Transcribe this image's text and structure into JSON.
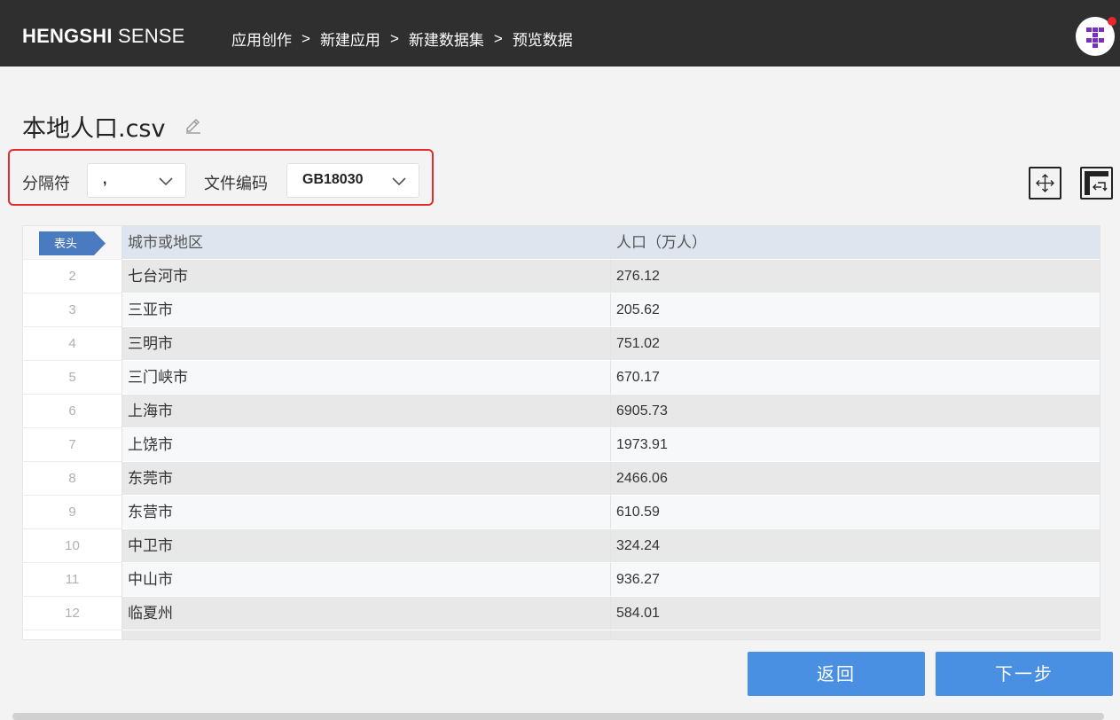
{
  "app": {
    "logo_bold": "HENGSHI",
    "logo_light": " SENSE"
  },
  "breadcrumb": [
    {
      "label": "应用创作"
    },
    {
      "label": "新建应用"
    },
    {
      "label": "新建数据集"
    },
    {
      "label": "预览数据"
    }
  ],
  "breadcrumb_separator": ">",
  "page": {
    "title": "本地人口.csv"
  },
  "options": {
    "delimiter_label": "分隔符",
    "delimiter_value": ",",
    "encoding_label": "文件编码",
    "encoding_value": "GB18030"
  },
  "table": {
    "header_tag": "表头",
    "columns": [
      "城市或地区",
      "人口（万人）"
    ],
    "rows": [
      {
        "n": "2",
        "city": "七台河市",
        "pop": "276.12"
      },
      {
        "n": "3",
        "city": "三亚市",
        "pop": "205.62"
      },
      {
        "n": "4",
        "city": "三明市",
        "pop": "751.02"
      },
      {
        "n": "5",
        "city": "三门峡市",
        "pop": "670.17"
      },
      {
        "n": "6",
        "city": "上海市",
        "pop": "6905.73"
      },
      {
        "n": "7",
        "city": "上饶市",
        "pop": "1973.91"
      },
      {
        "n": "8",
        "city": "东莞市",
        "pop": "2466.06"
      },
      {
        "n": "9",
        "city": "东营市",
        "pop": "610.59"
      },
      {
        "n": "10",
        "city": "中卫市",
        "pop": "324.24"
      },
      {
        "n": "11",
        "city": "中山市",
        "pop": "936.27"
      },
      {
        "n": "12",
        "city": "临夏州",
        "pop": "584.01"
      }
    ]
  },
  "footer": {
    "back_label": "返回",
    "next_label": "下一步"
  },
  "colors": {
    "topbar": "#2f2f2f",
    "primary": "#4a90e2",
    "highlight_border": "#e42a2a",
    "avatar_accent": "#7b2fbe",
    "notification_dot": "#e8262d"
  }
}
